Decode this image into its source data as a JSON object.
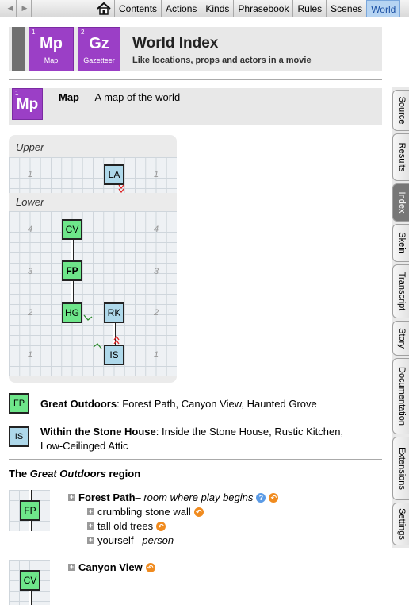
{
  "nav": {
    "tabs": [
      "Contents",
      "Actions",
      "Kinds",
      "Phrasebook",
      "Rules",
      "Scenes",
      "World"
    ],
    "active_tab": "World"
  },
  "sidebar": {
    "tabs": [
      "Source",
      "Results",
      "Index",
      "Skein",
      "Transcript",
      "Story",
      "Documentation",
      "Extensions",
      "Settings"
    ],
    "active": "Index"
  },
  "header": {
    "tile1": {
      "num": "1",
      "abbr": "Mp",
      "label": "Map"
    },
    "tile2": {
      "num": "2",
      "abbr": "Gz",
      "label": "Gazetteer"
    },
    "title": "World Index",
    "subtitle": "Like locations, props and actors in a movie"
  },
  "map_section": {
    "tile": {
      "num": "1",
      "abbr": "Mp"
    },
    "name": "Map",
    "desc": " — A map of the world"
  },
  "map": {
    "levels": [
      "Upper",
      "Lower"
    ],
    "upper_rows": [
      "1",
      "1"
    ],
    "lower_rows": [
      "4",
      "4",
      "3",
      "3",
      "2",
      "2",
      "1",
      "1"
    ],
    "rooms": [
      "LA",
      "CV",
      "FP",
      "HG",
      "RK",
      "IS"
    ]
  },
  "legend": [
    {
      "code": "FP",
      "region": "Great Outdoors",
      "rooms": ": Forest Path, Canyon View, Haunted Grove",
      "color": "#6ee68a"
    },
    {
      "code": "IS",
      "region": "Within the Stone House",
      "rooms": ": Inside the Stone House, Rustic Kitchen,",
      "rooms2": "Low-Ceilinged Attic",
      "color": "#aed8ea"
    }
  ],
  "region": {
    "prefix": "The ",
    "name": "Great Outdoors",
    "suffix": " region"
  },
  "index": {
    "forest_path": {
      "code": "FP",
      "name": "Forest Path",
      "note": " – room where play begins"
    },
    "items": [
      {
        "name": "crumbling stone wall",
        "note": ""
      },
      {
        "name": "tall old trees",
        "note": ""
      },
      {
        "name": "yourself",
        "note": " – person"
      }
    ],
    "canyon_view": {
      "code": "CV",
      "name": "Canyon View"
    }
  },
  "colors": {
    "accent": "#9b3fc6",
    "outdoor": "#6ee68a",
    "indoor": "#aed8ea",
    "orange": "#f08b1f"
  }
}
